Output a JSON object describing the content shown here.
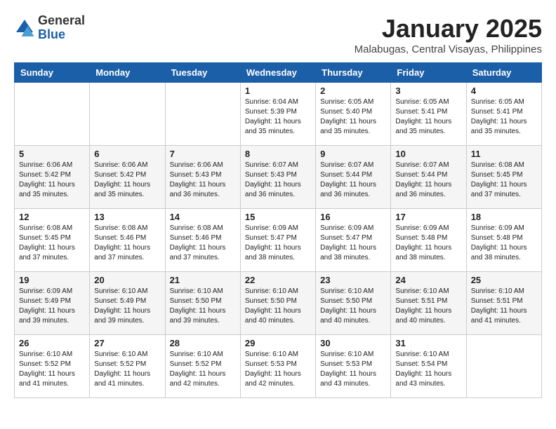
{
  "header": {
    "logo_general": "General",
    "logo_blue": "Blue",
    "month": "January 2025",
    "location": "Malabugas, Central Visayas, Philippines"
  },
  "days_of_week": [
    "Sunday",
    "Monday",
    "Tuesday",
    "Wednesday",
    "Thursday",
    "Friday",
    "Saturday"
  ],
  "weeks": [
    [
      {
        "day": "",
        "info": ""
      },
      {
        "day": "",
        "info": ""
      },
      {
        "day": "",
        "info": ""
      },
      {
        "day": "1",
        "info": "Sunrise: 6:04 AM\nSunset: 5:39 PM\nDaylight: 11 hours\nand 35 minutes."
      },
      {
        "day": "2",
        "info": "Sunrise: 6:05 AM\nSunset: 5:40 PM\nDaylight: 11 hours\nand 35 minutes."
      },
      {
        "day": "3",
        "info": "Sunrise: 6:05 AM\nSunset: 5:41 PM\nDaylight: 11 hours\nand 35 minutes."
      },
      {
        "day": "4",
        "info": "Sunrise: 6:05 AM\nSunset: 5:41 PM\nDaylight: 11 hours\nand 35 minutes."
      }
    ],
    [
      {
        "day": "5",
        "info": "Sunrise: 6:06 AM\nSunset: 5:42 PM\nDaylight: 11 hours\nand 35 minutes."
      },
      {
        "day": "6",
        "info": "Sunrise: 6:06 AM\nSunset: 5:42 PM\nDaylight: 11 hours\nand 35 minutes."
      },
      {
        "day": "7",
        "info": "Sunrise: 6:06 AM\nSunset: 5:43 PM\nDaylight: 11 hours\nand 36 minutes."
      },
      {
        "day": "8",
        "info": "Sunrise: 6:07 AM\nSunset: 5:43 PM\nDaylight: 11 hours\nand 36 minutes."
      },
      {
        "day": "9",
        "info": "Sunrise: 6:07 AM\nSunset: 5:44 PM\nDaylight: 11 hours\nand 36 minutes."
      },
      {
        "day": "10",
        "info": "Sunrise: 6:07 AM\nSunset: 5:44 PM\nDaylight: 11 hours\nand 36 minutes."
      },
      {
        "day": "11",
        "info": "Sunrise: 6:08 AM\nSunset: 5:45 PM\nDaylight: 11 hours\nand 37 minutes."
      }
    ],
    [
      {
        "day": "12",
        "info": "Sunrise: 6:08 AM\nSunset: 5:45 PM\nDaylight: 11 hours\nand 37 minutes."
      },
      {
        "day": "13",
        "info": "Sunrise: 6:08 AM\nSunset: 5:46 PM\nDaylight: 11 hours\nand 37 minutes."
      },
      {
        "day": "14",
        "info": "Sunrise: 6:08 AM\nSunset: 5:46 PM\nDaylight: 11 hours\nand 37 minutes."
      },
      {
        "day": "15",
        "info": "Sunrise: 6:09 AM\nSunset: 5:47 PM\nDaylight: 11 hours\nand 38 minutes."
      },
      {
        "day": "16",
        "info": "Sunrise: 6:09 AM\nSunset: 5:47 PM\nDaylight: 11 hours\nand 38 minutes."
      },
      {
        "day": "17",
        "info": "Sunrise: 6:09 AM\nSunset: 5:48 PM\nDaylight: 11 hours\nand 38 minutes."
      },
      {
        "day": "18",
        "info": "Sunrise: 6:09 AM\nSunset: 5:48 PM\nDaylight: 11 hours\nand 38 minutes."
      }
    ],
    [
      {
        "day": "19",
        "info": "Sunrise: 6:09 AM\nSunset: 5:49 PM\nDaylight: 11 hours\nand 39 minutes."
      },
      {
        "day": "20",
        "info": "Sunrise: 6:10 AM\nSunset: 5:49 PM\nDaylight: 11 hours\nand 39 minutes."
      },
      {
        "day": "21",
        "info": "Sunrise: 6:10 AM\nSunset: 5:50 PM\nDaylight: 11 hours\nand 39 minutes."
      },
      {
        "day": "22",
        "info": "Sunrise: 6:10 AM\nSunset: 5:50 PM\nDaylight: 11 hours\nand 40 minutes."
      },
      {
        "day": "23",
        "info": "Sunrise: 6:10 AM\nSunset: 5:50 PM\nDaylight: 11 hours\nand 40 minutes."
      },
      {
        "day": "24",
        "info": "Sunrise: 6:10 AM\nSunset: 5:51 PM\nDaylight: 11 hours\nand 40 minutes."
      },
      {
        "day": "25",
        "info": "Sunrise: 6:10 AM\nSunset: 5:51 PM\nDaylight: 11 hours\nand 41 minutes."
      }
    ],
    [
      {
        "day": "26",
        "info": "Sunrise: 6:10 AM\nSunset: 5:52 PM\nDaylight: 11 hours\nand 41 minutes."
      },
      {
        "day": "27",
        "info": "Sunrise: 6:10 AM\nSunset: 5:52 PM\nDaylight: 11 hours\nand 41 minutes."
      },
      {
        "day": "28",
        "info": "Sunrise: 6:10 AM\nSunset: 5:52 PM\nDaylight: 11 hours\nand 42 minutes."
      },
      {
        "day": "29",
        "info": "Sunrise: 6:10 AM\nSunset: 5:53 PM\nDaylight: 11 hours\nand 42 minutes."
      },
      {
        "day": "30",
        "info": "Sunrise: 6:10 AM\nSunset: 5:53 PM\nDaylight: 11 hours\nand 43 minutes."
      },
      {
        "day": "31",
        "info": "Sunrise: 6:10 AM\nSunset: 5:54 PM\nDaylight: 11 hours\nand 43 minutes."
      },
      {
        "day": "",
        "info": ""
      }
    ]
  ]
}
